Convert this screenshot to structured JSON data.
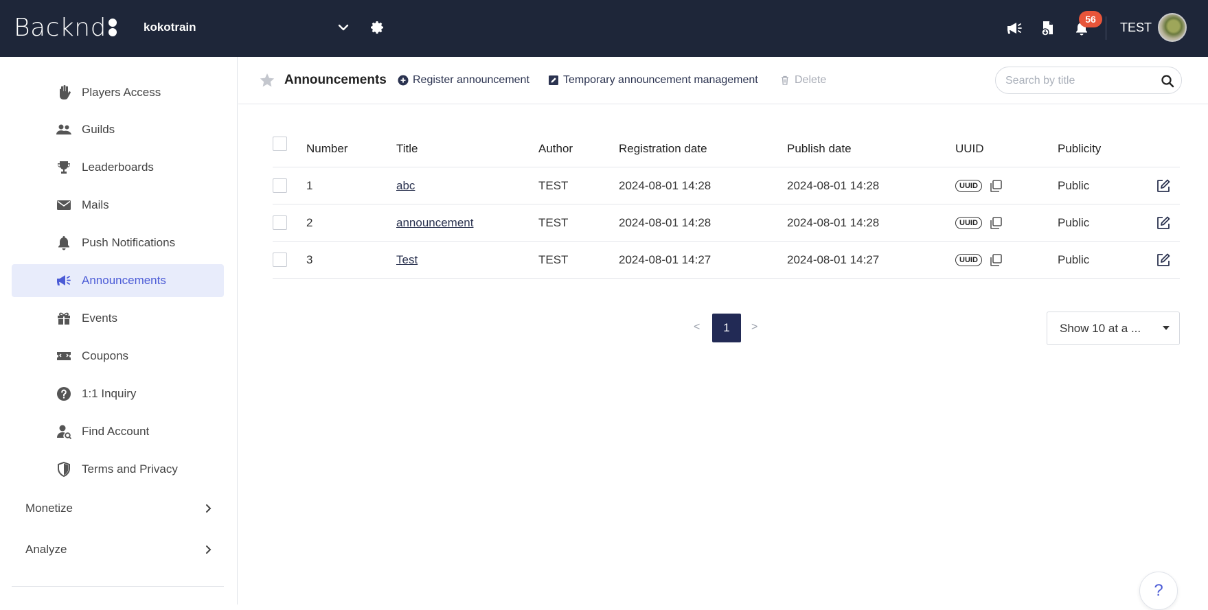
{
  "topbar": {
    "logo_text": "Backnd",
    "project_name": "kokotrain",
    "notification_count": "56",
    "username": "TEST"
  },
  "sidebar": {
    "items": [
      {
        "label": "Players Access",
        "icon": "hand-icon"
      },
      {
        "label": "Guilds",
        "icon": "users-icon"
      },
      {
        "label": "Leaderboards",
        "icon": "trophy-icon"
      },
      {
        "label": "Mails",
        "icon": "envelope-icon"
      },
      {
        "label": "Push Notifications",
        "icon": "bell-icon"
      },
      {
        "label": "Announcements",
        "icon": "megaphone-icon",
        "active": true
      },
      {
        "label": "Events",
        "icon": "gift-icon"
      },
      {
        "label": "Coupons",
        "icon": "ticket-icon"
      },
      {
        "label": "1:1 Inquiry",
        "icon": "question-circle-icon"
      },
      {
        "label": "Find Account",
        "icon": "user-search-icon"
      },
      {
        "label": "Terms and Privacy",
        "icon": "shield-icon"
      }
    ],
    "groups": [
      {
        "label": "Monetize"
      },
      {
        "label": "Analyze"
      }
    ]
  },
  "header": {
    "title": "Announcements",
    "register_label": "Register announcement",
    "temp_label": "Temporary announcement management",
    "delete_label": "Delete",
    "search_placeholder": "Search by title"
  },
  "table": {
    "columns": [
      "Number",
      "Title",
      "Author",
      "Registration date",
      "Publish date",
      "UUID",
      "Publicity"
    ],
    "uuid_tag": "UUID",
    "rows": [
      {
        "number": "1",
        "title": "abc",
        "author": "TEST",
        "registration_date": "2024-08-01 14:28",
        "publish_date": "2024-08-01 14:28",
        "publicity": "Public"
      },
      {
        "number": "2",
        "title": "announcement",
        "author": "TEST",
        "registration_date": "2024-08-01 14:28",
        "publish_date": "2024-08-01 14:28",
        "publicity": "Public"
      },
      {
        "number": "3",
        "title": "Test",
        "author": "TEST",
        "registration_date": "2024-08-01 14:27",
        "publish_date": "2024-08-01 14:27",
        "publicity": "Public"
      }
    ]
  },
  "pagination": {
    "prev": "<",
    "current": "1",
    "next": ">",
    "page_size_label": "Show 10 at a ..."
  },
  "help_label": "?",
  "colors": {
    "topbar_bg": "#1e2639",
    "accent": "#4b5bd6",
    "active_bg": "#e8ecfb",
    "badge": "#e8553a",
    "page_current": "#222a55"
  }
}
